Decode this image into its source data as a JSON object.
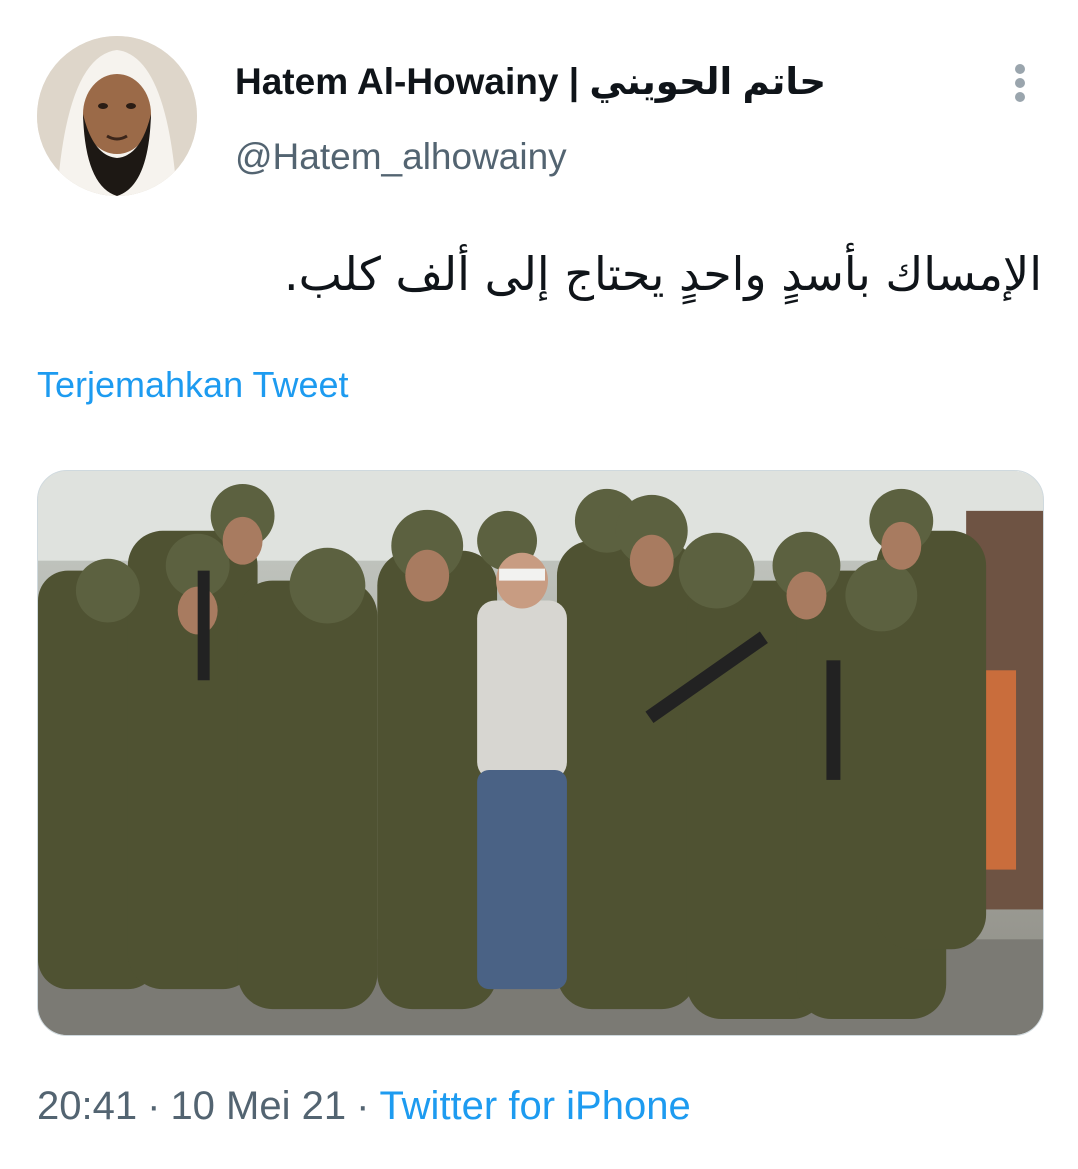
{
  "tweet": {
    "author": {
      "display_name": "Hatem Al-Howainy | حاتم الحويني",
      "handle": "@Hatem_alhowainy"
    },
    "text": "الإمساك بأسدٍ واحدٍ يحتاج إلى ألف كلب.",
    "translate_label": "Terjemahkan Tweet",
    "meta": {
      "time": "20:41",
      "date": "10 Mei 21",
      "separator": "·",
      "source": "Twitter for iPhone"
    },
    "icons": {
      "more": "more-vertical-icon"
    },
    "colors": {
      "link": "#1d9bf0",
      "secondary": "#536471",
      "primary": "#0f1419"
    }
  }
}
